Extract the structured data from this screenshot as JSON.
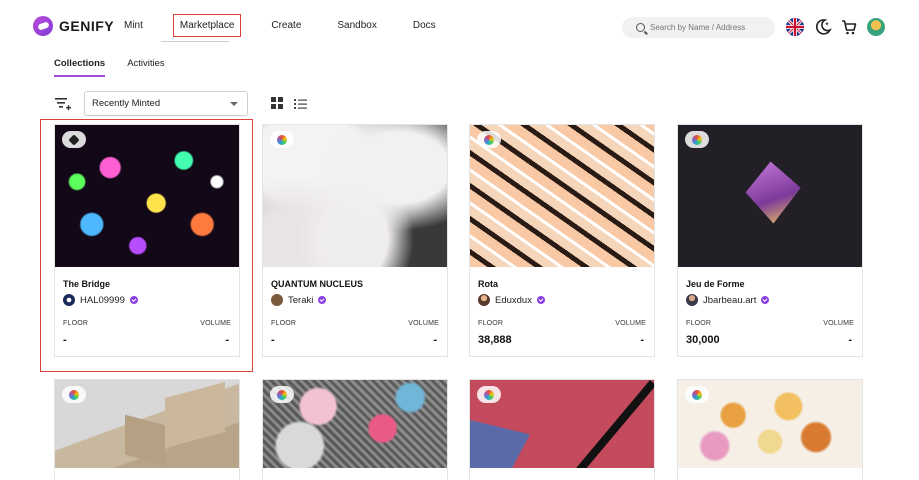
{
  "brand": {
    "name": "GENIFY"
  },
  "nav": [
    "Mint",
    "Marketplace",
    "Create",
    "Sandbox",
    "Docs"
  ],
  "search": {
    "placeholder": "Search by Name / Address"
  },
  "tabs": [
    "Collections",
    "Activities"
  ],
  "sort": {
    "selected": "Recently Minted"
  },
  "labels": {
    "floor": "FLOOR",
    "volume": "VOLUME"
  },
  "collections": [
    {
      "title": "The Bridge",
      "creator": "HAL09999",
      "floor": "-",
      "volume": "-"
    },
    {
      "title": "QUANTUM NUCLEUS",
      "creator": "Teraki",
      "floor": "-",
      "volume": "-"
    },
    {
      "title": "Rota",
      "creator": "Eduxdux",
      "floor": "38,888",
      "volume": "-"
    },
    {
      "title": "Jeu de Forme",
      "creator": "Jbarbeau.art",
      "floor": "30,000",
      "volume": "-"
    }
  ],
  "colors": {
    "accent": "#8a3ee0",
    "highlight": "#e0413b"
  }
}
